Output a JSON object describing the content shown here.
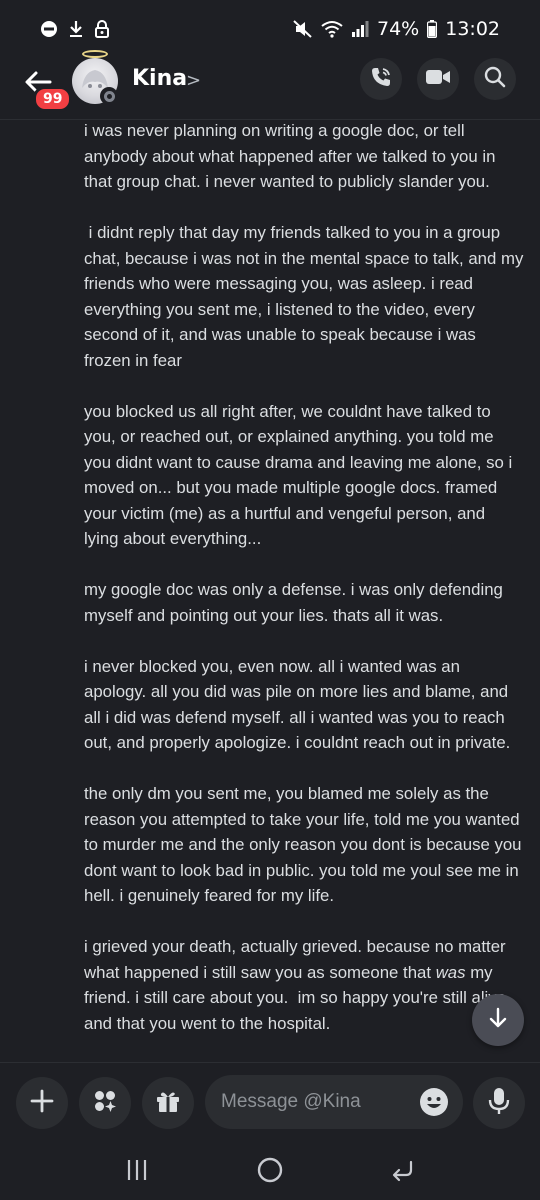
{
  "status_bar": {
    "battery": "74%",
    "time": "13:02",
    "icons": [
      "do-not-disturb-icon",
      "download-icon",
      "lock-icon",
      "mute-icon",
      "wifi-icon",
      "signal-icon",
      "battery-icon"
    ]
  },
  "header": {
    "unread_badge": "99",
    "title": "Kina",
    "chevron": ">",
    "actions": [
      "voice-call-icon",
      "video-call-icon",
      "search-icon"
    ]
  },
  "messages": {
    "p1": "i was never planning on writing a google doc, or tell anybody about what happened after we talked to you in that group chat. i never wanted to publicly slander you.",
    "p2": " i didnt reply that day my friends talked to you in a group chat, because i was not in the mental space to talk, and my friends who were messaging you, was asleep. i read everything you sent me, i listened to the video, every second of it, and was unable to speak because i was frozen in fear",
    "p3": "you blocked us all right after, we couldnt have talked to you, or reached out, or explained anything. you told me you didnt want to cause drama and leaving me alone, so i moved on... but you made multiple google docs. framed your victim (me) as a hurtful and vengeful person, and lying about everything...",
    "p4": "my google doc was only a defense. i was only defending myself and pointing out your lies. thats all it was.",
    "p5": "i never blocked you, even now. all i wanted was an apology. all you did was pile on more lies and blame, and all i did was defend myself. all i wanted was you to reach out, and properly apologize. i couldnt reach out in private.",
    "p6": "the only dm you sent me, you blamed me solely as the reason you attempted to take your life, told me you wanted to murder me and the only reason you dont is because you dont want to look bad in public. you told me youl see me in hell. i genuinely feared for my life.",
    "p7_a": "i grieved your death, actually grieved. because no matter what happened i still saw you as someone that ",
    "p7_em": "was",
    "p7_b": " my friend. i still care about you.  im so happy you're still alive. and that you went to the hospital."
  },
  "composer": {
    "placeholder": "Message @Kina"
  }
}
